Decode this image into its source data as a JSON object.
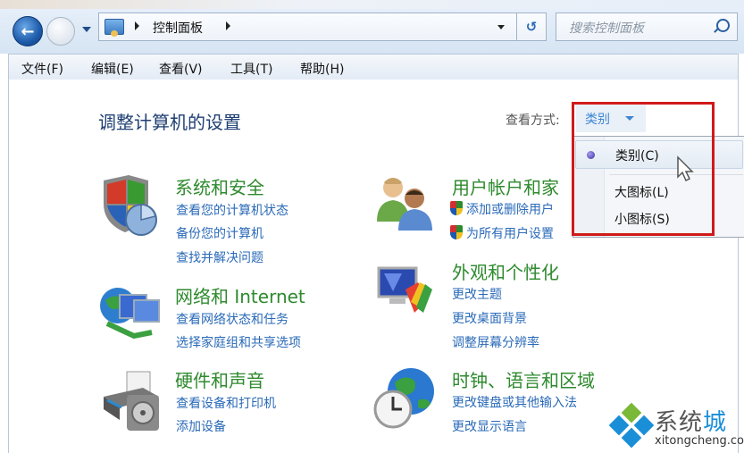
{
  "window": {
    "breadcrumb": [
      "控制面板"
    ],
    "search_placeholder": "搜索控制面板"
  },
  "menubar": {
    "items": [
      "文件(F)",
      "编辑(E)",
      "查看(V)",
      "工具(T)",
      "帮助(H)"
    ]
  },
  "main": {
    "title": "调整计算机的设置",
    "view_by_label": "查看方式:",
    "view_by_value": "类别",
    "view_menu": {
      "options": [
        "类别(C)",
        "大图标(L)",
        "小图标(S)"
      ],
      "selected": "类别(C)"
    },
    "categories": [
      {
        "title": "系统和安全",
        "icon": "shield-icon",
        "links": [
          "查看您的计算机状态",
          "备份您的计算机",
          "查找并解决问题"
        ]
      },
      {
        "title": "网络和 Internet",
        "icon": "network-icon",
        "links": [
          "查看网络状态和任务",
          "选择家庭组和共享选项"
        ]
      },
      {
        "title": "硬件和声音",
        "icon": "printer-icon",
        "links": [
          "查看设备和打印机",
          "添加设备"
        ]
      },
      {
        "title": "用户帐户和家",
        "icon": "users-icon",
        "links": [
          "添加或删除用户",
          "为所有用户设置"
        ]
      },
      {
        "title": "外观和个性化",
        "icon": "appearance-icon",
        "links": [
          "更改主题",
          "更改桌面背景",
          "调整屏幕分辨率"
        ]
      },
      {
        "title": "时钟、语言和区域",
        "icon": "globe-clock-icon",
        "links": [
          "更改键盘或其他输入法",
          "更改显示语言"
        ]
      }
    ]
  },
  "watermark": {
    "brand_gray": "系统",
    "brand_blue": "城",
    "url": "xitongcheng.com"
  },
  "colors": {
    "title_blue": "#1e3f73",
    "category_green": "#2e8a2e",
    "link_blue": "#2a6ab8",
    "highlight_red": "#d11a1a"
  }
}
